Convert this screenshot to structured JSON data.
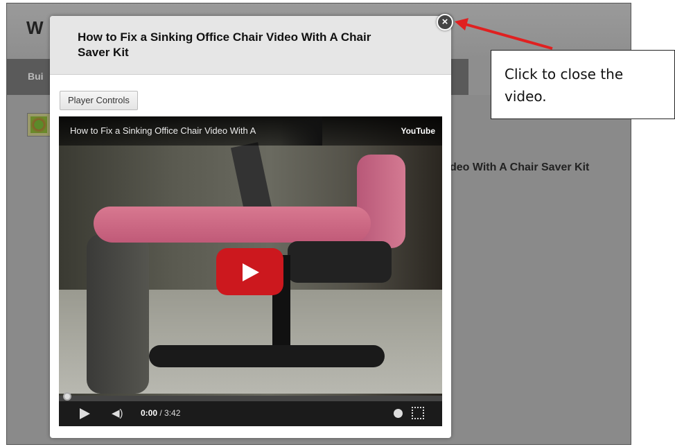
{
  "background_page": {
    "site_title": "W",
    "nav_item": "Bui",
    "post_title_fragment": "deo With A Chair Saver Kit"
  },
  "modal": {
    "title": "How to Fix a Sinking Office Chair Video With A Chair Saver Kit",
    "player_controls_label": "Player Controls",
    "close_glyph": "×"
  },
  "video": {
    "title": "How to Fix a Sinking Office Chair Video With A",
    "brand": "YouTube",
    "current_time": "0:00",
    "duration": "/ 3:42",
    "progress": 0
  },
  "callout": {
    "text": "Click to close the video."
  },
  "colors": {
    "play_button": "#cc181e",
    "arrow": "#e02020"
  }
}
